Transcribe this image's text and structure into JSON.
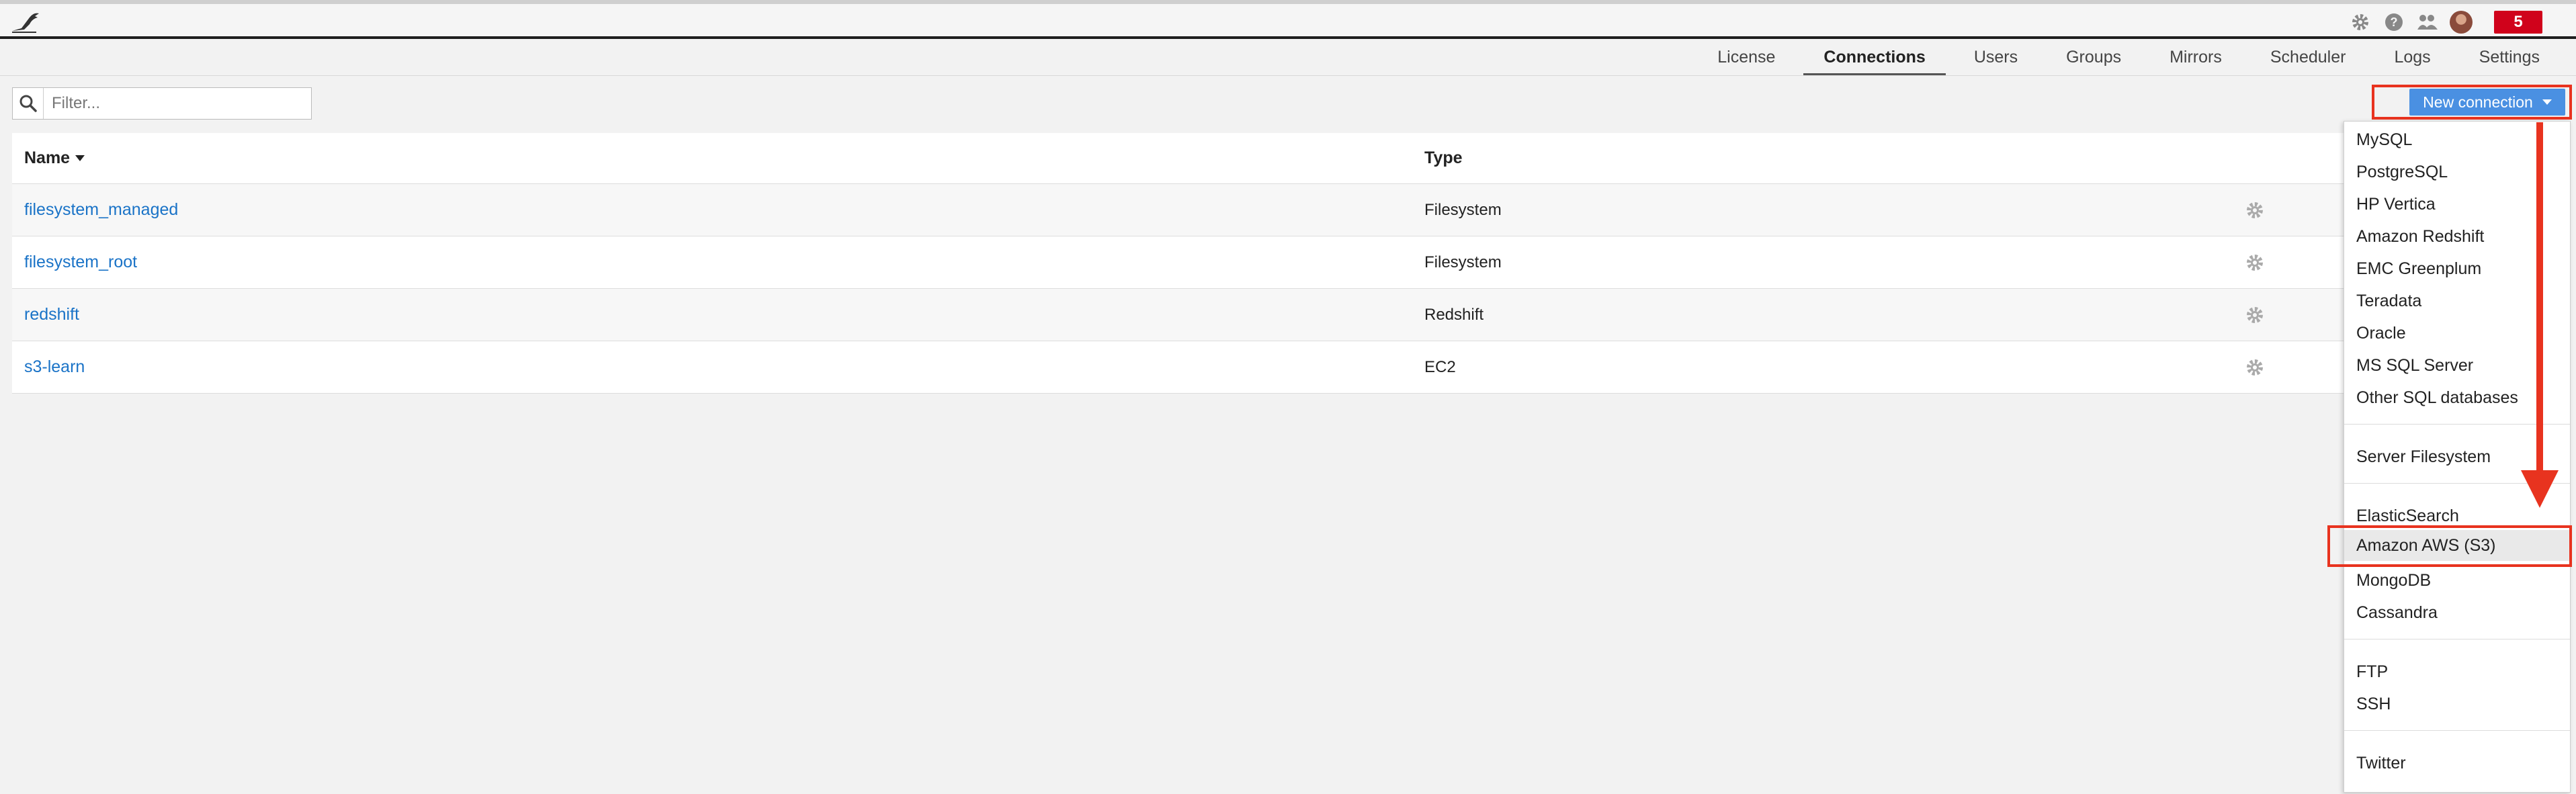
{
  "topbar": {
    "icons": [
      "logo-bird-icon",
      "gear-icon",
      "help-icon",
      "users-icon",
      "avatar"
    ],
    "notification_count": "5"
  },
  "tabs": [
    {
      "label": "License",
      "active": false
    },
    {
      "label": "Connections",
      "active": true
    },
    {
      "label": "Users",
      "active": false
    },
    {
      "label": "Groups",
      "active": false
    },
    {
      "label": "Mirrors",
      "active": false
    },
    {
      "label": "Scheduler",
      "active": false
    },
    {
      "label": "Logs",
      "active": false
    },
    {
      "label": "Settings",
      "active": false
    }
  ],
  "filter": {
    "placeholder": "Filter...",
    "value": ""
  },
  "new_connection": {
    "label": "New connection"
  },
  "table": {
    "columns": {
      "name": "Name",
      "type": "Type"
    },
    "rows": [
      {
        "name": "filesystem_managed",
        "type": "Filesystem"
      },
      {
        "name": "filesystem_root",
        "type": "Filesystem"
      },
      {
        "name": "redshift",
        "type": "Redshift"
      },
      {
        "name": "s3-learn",
        "type": "EC2"
      }
    ]
  },
  "dropdown": {
    "groups": [
      [
        "MySQL",
        "PostgreSQL",
        "HP Vertica",
        "Amazon Redshift",
        "EMC Greenplum",
        "Teradata",
        "Oracle",
        "MS SQL Server",
        "Other SQL databases"
      ],
      [
        "Server Filesystem"
      ],
      [
        "ElasticSearch",
        "Amazon AWS (S3)",
        "MongoDB",
        "Cassandra"
      ],
      [
        "FTP",
        "SSH"
      ],
      [
        "Twitter"
      ]
    ],
    "highlighted": "Amazon AWS (S3)"
  },
  "colors": {
    "accent": "#4a90e2",
    "annotation": "#e8331f",
    "link": "#1a73c7",
    "badge": "#d0021b"
  }
}
